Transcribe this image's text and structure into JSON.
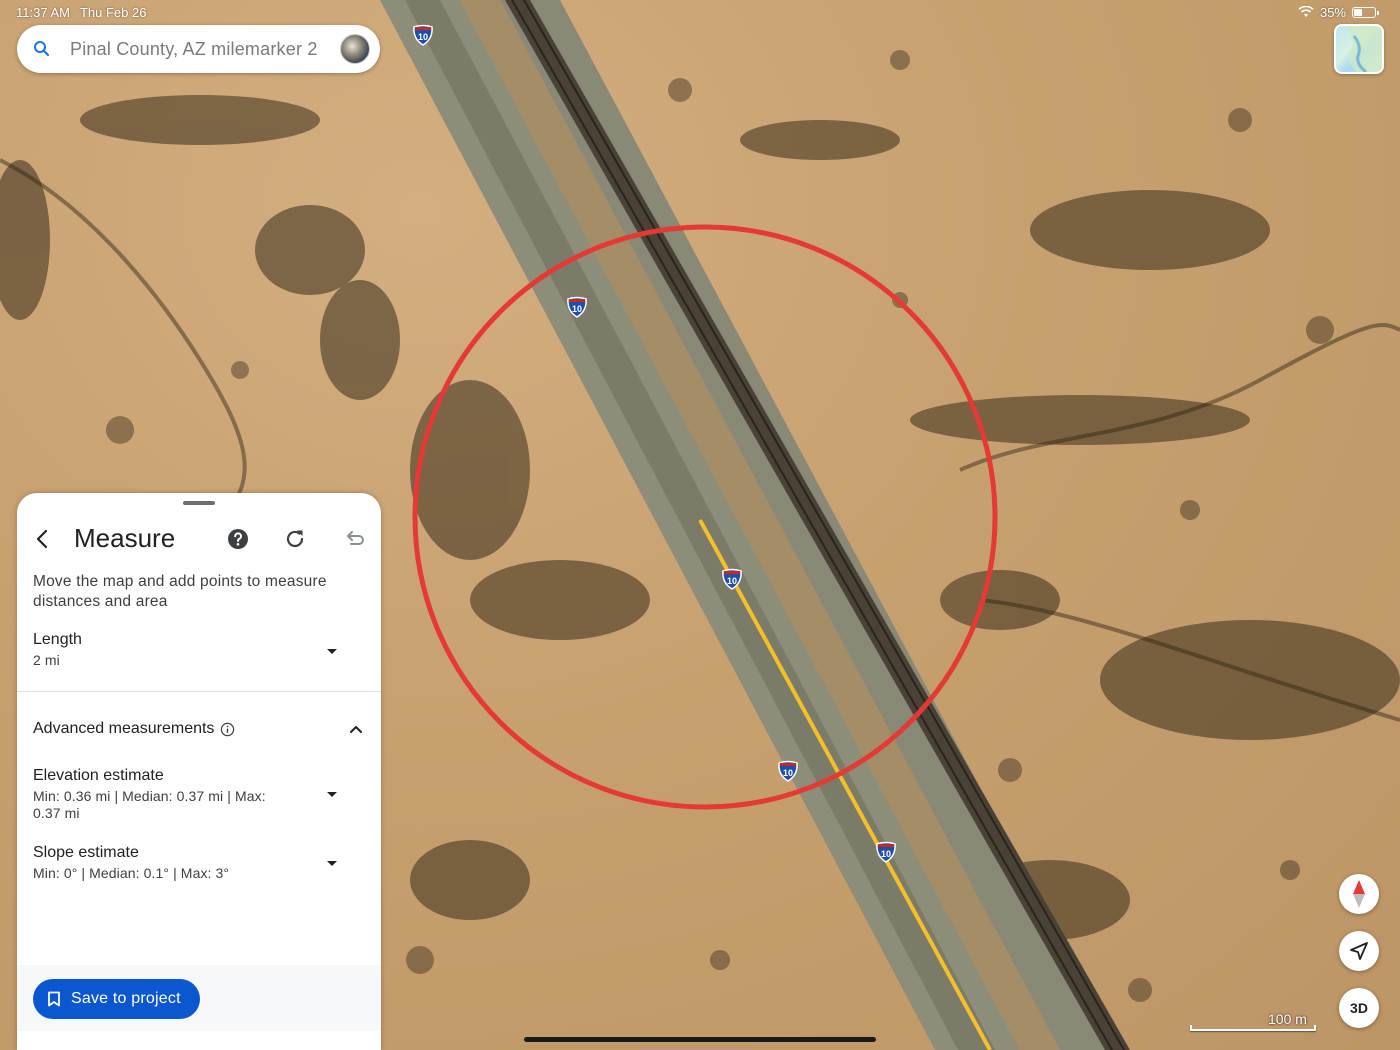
{
  "status_bar": {
    "time": "11:37 AM",
    "date": "Thu Feb 26",
    "battery": "35%",
    "wifi_icon": "wifi-icon",
    "battery_icon": "battery-icon"
  },
  "search": {
    "value": "Pinal County, AZ milemarker 2",
    "icon": "search-icon",
    "avatar_icon": "avatar"
  },
  "map": {
    "highway_shield_label": "10",
    "circle_color": "#e53935",
    "scale_label": "100 m"
  },
  "measure_panel": {
    "title": "Measure",
    "instructions": "Move the map and add points to measure distances and area",
    "length": {
      "label": "Length",
      "value": "2 mi"
    },
    "advanced": {
      "label": "Advanced measurements",
      "expanded": true
    },
    "elevation": {
      "label": "Elevation estimate",
      "value": "Min: 0.36 mi | Median: 0.37 mi | Max: 0.37 mi"
    },
    "slope": {
      "label": "Slope estimate",
      "value": "Min: 0° | Median: 0.1° | Max: 3°"
    },
    "save_button": "Save to project"
  },
  "controls": {
    "button_3d": "3D"
  },
  "colors": {
    "accent": "#0b57d0",
    "circle": "#e53935",
    "road_centerline": "#f2c029"
  }
}
